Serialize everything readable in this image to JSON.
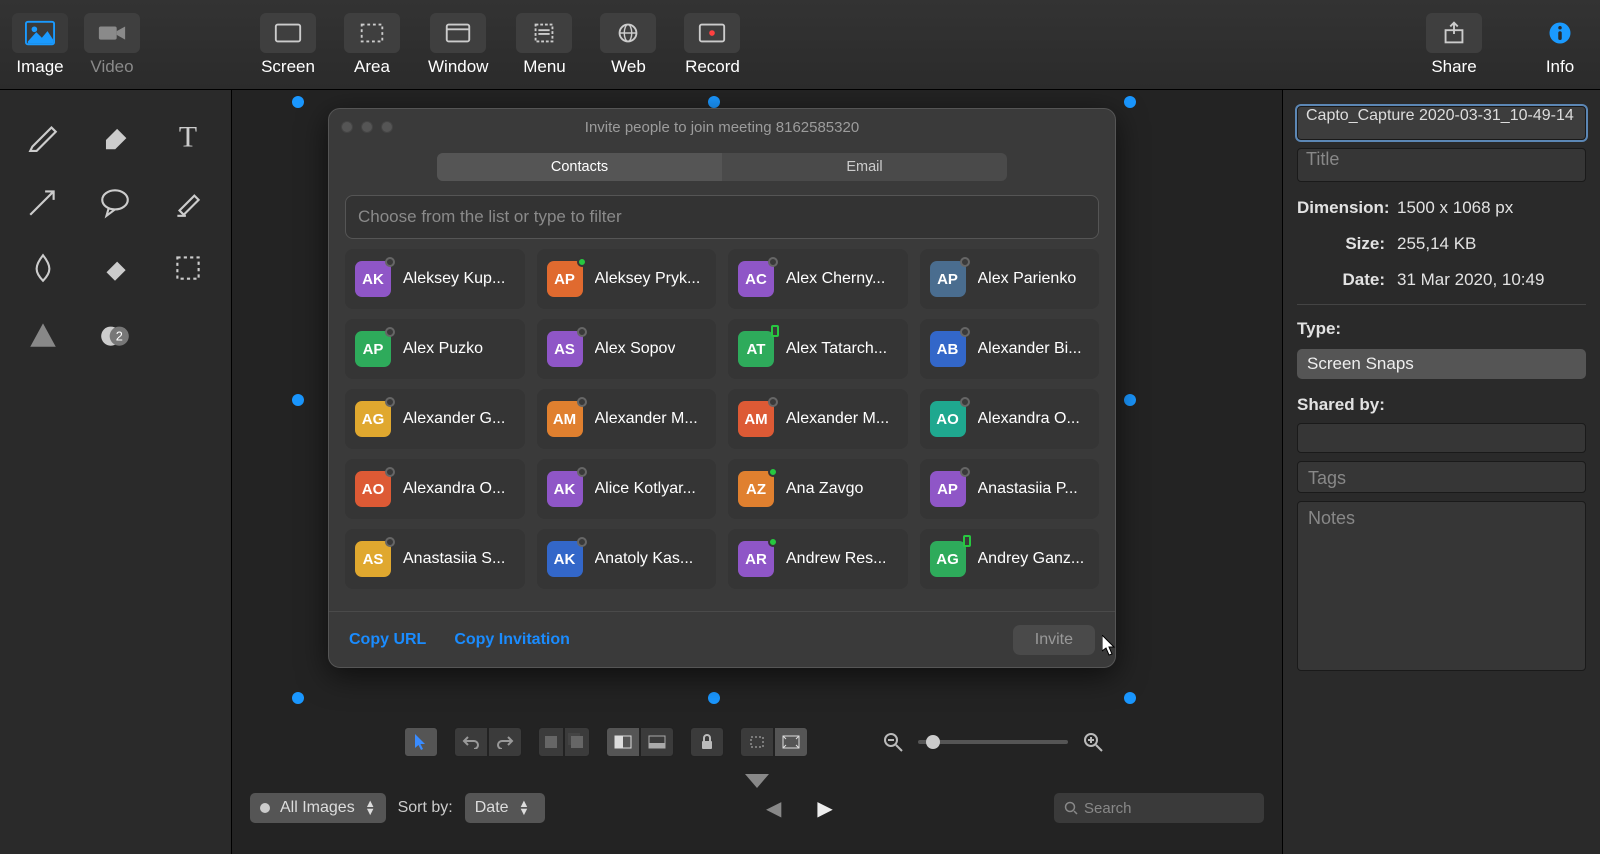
{
  "topbar": {
    "image": "Image",
    "video": "Video",
    "screen": "Screen",
    "area": "Area",
    "window": "Window",
    "menu": "Menu",
    "web": "Web",
    "record": "Record",
    "share": "Share",
    "info": "Info"
  },
  "right_panel": {
    "filename": "Capto_Capture 2020-03-31_10-49-14",
    "title_placeholder": "Title",
    "dimension_label": "Dimension:",
    "dimension_value": "1500 x 1068 px",
    "size_label": "Size:",
    "size_value": "255,14 KB",
    "date_label": "Date:",
    "date_value": "31 Mar 2020, 10:49",
    "type_label": "Type:",
    "type_value": "Screen Snaps",
    "shared_label": "Shared by:",
    "tags_placeholder": "Tags",
    "notes_placeholder": "Notes"
  },
  "dialog": {
    "title": "Invite people to join meeting 8162585320",
    "tab_contacts": "Contacts",
    "tab_email": "Email",
    "search_placeholder": "Choose from the list or type to filter",
    "copy_url": "Copy URL",
    "copy_invitation": "Copy Invitation",
    "invite": "Invite",
    "contacts": [
      {
        "initials": "AK",
        "name": "Aleksey Kup...",
        "color": "#8f56c7",
        "presence": "offline"
      },
      {
        "initials": "AP",
        "name": "Aleksey Pryk...",
        "color": "#e06a2f",
        "presence": "online"
      },
      {
        "initials": "AC",
        "name": "Alex Cherny...",
        "color": "#8f56c7",
        "presence": "offline"
      },
      {
        "initials": "AP",
        "name": "Alex Parienko",
        "color": "#4a6d8f",
        "presence": "offline"
      },
      {
        "initials": "AP",
        "name": "Alex Puzko",
        "color": "#2eab5b",
        "presence": "offline"
      },
      {
        "initials": "AS",
        "name": "Alex Sopov",
        "color": "#8f56c7",
        "presence": "offline"
      },
      {
        "initials": "AT",
        "name": "Alex Tatarch...",
        "color": "#2eab5b",
        "presence": "mobile"
      },
      {
        "initials": "AB",
        "name": "Alexander Bi...",
        "color": "#3367c9",
        "presence": "offline"
      },
      {
        "initials": "AG",
        "name": "Alexander G...",
        "color": "#e0a82f",
        "presence": "offline"
      },
      {
        "initials": "AM",
        "name": "Alexander M...",
        "color": "#e0802f",
        "presence": "offline"
      },
      {
        "initials": "AM",
        "name": "Alexander M...",
        "color": "#dd5a35",
        "presence": "offline"
      },
      {
        "initials": "AO",
        "name": "Alexandra O...",
        "color": "#1fa88f",
        "presence": "offline"
      },
      {
        "initials": "AO",
        "name": "Alexandra O...",
        "color": "#dd5a35",
        "presence": "offline"
      },
      {
        "initials": "AK",
        "name": "Alice Kotlyar...",
        "color": "#8f56c7",
        "presence": "offline"
      },
      {
        "initials": "AZ",
        "name": "Ana Zavgo",
        "color": "#e0802f",
        "presence": "online"
      },
      {
        "initials": "AP",
        "name": "Anastasiia P...",
        "color": "#8f56c7",
        "presence": "offline"
      },
      {
        "initials": "AS",
        "name": "Anastasiia S...",
        "color": "#e0a82f",
        "presence": "offline"
      },
      {
        "initials": "AK",
        "name": "Anatoly Kas...",
        "color": "#3367c9",
        "presence": "offline"
      },
      {
        "initials": "AR",
        "name": "Andrew Res...",
        "color": "#8f56c7",
        "presence": "online"
      },
      {
        "initials": "AG",
        "name": "Andrey Ganz...",
        "color": "#2eab5b",
        "presence": "mobile"
      }
    ]
  },
  "library_bar": {
    "filter": "All Images",
    "sort_label": "Sort by:",
    "sort_value": "Date",
    "search_placeholder": "Search"
  },
  "colors": {
    "accent": "#1a8cff"
  }
}
